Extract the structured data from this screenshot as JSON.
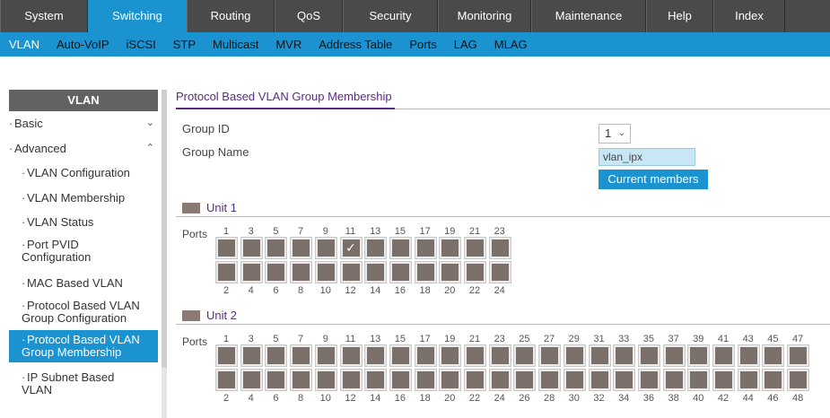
{
  "topnav": [
    {
      "label": "System",
      "width": 98
    },
    {
      "label": "Switching",
      "width": 110,
      "active": true
    },
    {
      "label": "Routing",
      "width": 98
    },
    {
      "label": "QoS",
      "width": 76
    },
    {
      "label": "Security",
      "width": 106
    },
    {
      "label": "Monitoring",
      "width": 104
    },
    {
      "label": "Maintenance",
      "width": 128
    },
    {
      "label": "Help",
      "width": 75
    },
    {
      "label": "Index",
      "width": 80
    }
  ],
  "subnav": [
    "VLAN",
    "Auto-VoIP",
    "iSCSI",
    "STP",
    "Multicast",
    "MVR",
    "Address Table",
    "Ports",
    "LAG",
    "MLAG"
  ],
  "sidebar": {
    "title": "VLAN",
    "items": [
      {
        "label": "Basic",
        "chev": "⌄"
      },
      {
        "label": "Advanced",
        "chev": "⌃"
      },
      {
        "label": "VLAN Configuration"
      },
      {
        "label": "VLAN Membership"
      },
      {
        "label": "VLAN Status"
      },
      {
        "label": "Port PVID Configuration"
      },
      {
        "label": "MAC Based VLAN"
      },
      {
        "label": "Protocol Based VLAN Group Configuration"
      },
      {
        "label": "Protocol Based VLAN Group Membership"
      },
      {
        "label": "IP Subnet Based VLAN"
      }
    ]
  },
  "main": {
    "title": "Protocol Based VLAN Group Membership",
    "group_id_label": "Group ID",
    "group_id_value": "1",
    "group_name_label": "Group Name",
    "group_name_value": "vlan_ipx",
    "current_members_label": "Current members",
    "ports_label": "Ports",
    "unit1": {
      "label": "Unit 1",
      "port_count": 24,
      "checked": [
        11
      ]
    },
    "unit2": {
      "label": "Unit 2",
      "port_count": 48,
      "checked": []
    }
  },
  "colors": {
    "accent": "#1b93d1",
    "nav": "#4a4a4a",
    "title": "#5c2a83",
    "port": "#7b6f69"
  }
}
